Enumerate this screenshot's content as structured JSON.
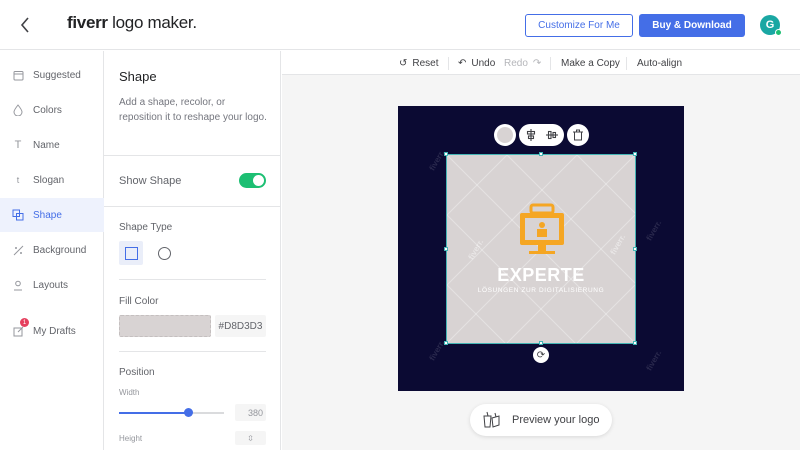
{
  "header": {
    "logo_brand": "fiverr",
    "logo_product": " logo maker.",
    "customize_label": "Customize For Me",
    "buy_label": "Buy & Download",
    "avatar_initial": "G"
  },
  "nav": {
    "items": [
      {
        "label": "Suggested",
        "icon": "calendar-icon"
      },
      {
        "label": "Colors",
        "icon": "droplet-icon"
      },
      {
        "label": "Name",
        "icon": "text-icon"
      },
      {
        "label": "Slogan",
        "icon": "small-text-icon"
      },
      {
        "label": "Shape",
        "icon": "shape-icon",
        "active": true
      },
      {
        "label": "Background",
        "icon": "slash-pattern-icon"
      },
      {
        "label": "Layouts",
        "icon": "person-icon"
      },
      {
        "label": "My Drafts",
        "icon": "drafts-icon",
        "badge": "1"
      }
    ]
  },
  "panel": {
    "title": "Shape",
    "description": "Add a shape, recolor, or reposition it to reshape your logo.",
    "show_shape_label": "Show Shape",
    "show_shape_on": true,
    "shape_type_label": "Shape Type",
    "fill_color_label": "Fill Color",
    "fill_color_hex": "#D8D3D3",
    "position_label": "Position",
    "width_label": "Width",
    "width_value": "380",
    "width_slider_fraction": 0.66,
    "height_label": "Height"
  },
  "toolbar": {
    "reset": "Reset",
    "undo": "Undo",
    "redo": "Redo",
    "make_copy": "Make a Copy",
    "auto_align": "Auto-align"
  },
  "canvas": {
    "background_color": "#0b0a33",
    "shape_color": "#D8D3D3",
    "logo_title": "EXPERTE",
    "logo_subtitle": "LÖSUNGEN ZUR DIGITALISIERUNG",
    "watermark": "fiverr.",
    "icon_color": "#f5a623",
    "preview_label": "Preview your logo"
  }
}
